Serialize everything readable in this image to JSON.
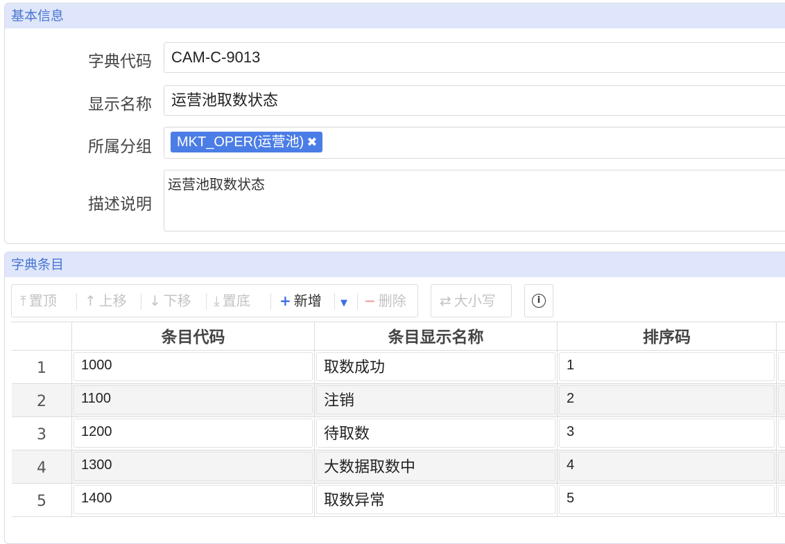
{
  "basic_info": {
    "title": "基本信息",
    "fields": {
      "code": {
        "label": "字典代码",
        "value": "CAM-C-9013"
      },
      "name": {
        "label": "显示名称",
        "value": "运营池取数状态"
      },
      "group": {
        "label": "所属分组",
        "tag": "MKT_OPER(运营池)",
        "remove_glyph": "✖"
      },
      "desc": {
        "label": "描述说明",
        "value": "运营池取数状态"
      }
    }
  },
  "dict_items": {
    "title": "字典条目",
    "toolbar": {
      "top": "置顶",
      "up": "上移",
      "down": "下移",
      "bottom": "置底",
      "add": "新增",
      "delete": "删除",
      "case": "大小写"
    },
    "columns": [
      "条目代码",
      "条目显示名称",
      "排序码"
    ],
    "rows": [
      {
        "no": "1",
        "code": "1000",
        "name": "取数成功",
        "sort": "1"
      },
      {
        "no": "2",
        "code": "1100",
        "name": "注销",
        "sort": "2"
      },
      {
        "no": "3",
        "code": "1200",
        "name": "待取数",
        "sort": "3"
      },
      {
        "no": "4",
        "code": "1300",
        "name": "大数据取数中",
        "sort": "4"
      },
      {
        "no": "5",
        "code": "1400",
        "name": "取数异常",
        "sort": "5"
      }
    ]
  },
  "colors": {
    "header_bg": "#dfe6fb",
    "header_text": "#4a77d0",
    "tag_bg": "#4b7de6"
  }
}
